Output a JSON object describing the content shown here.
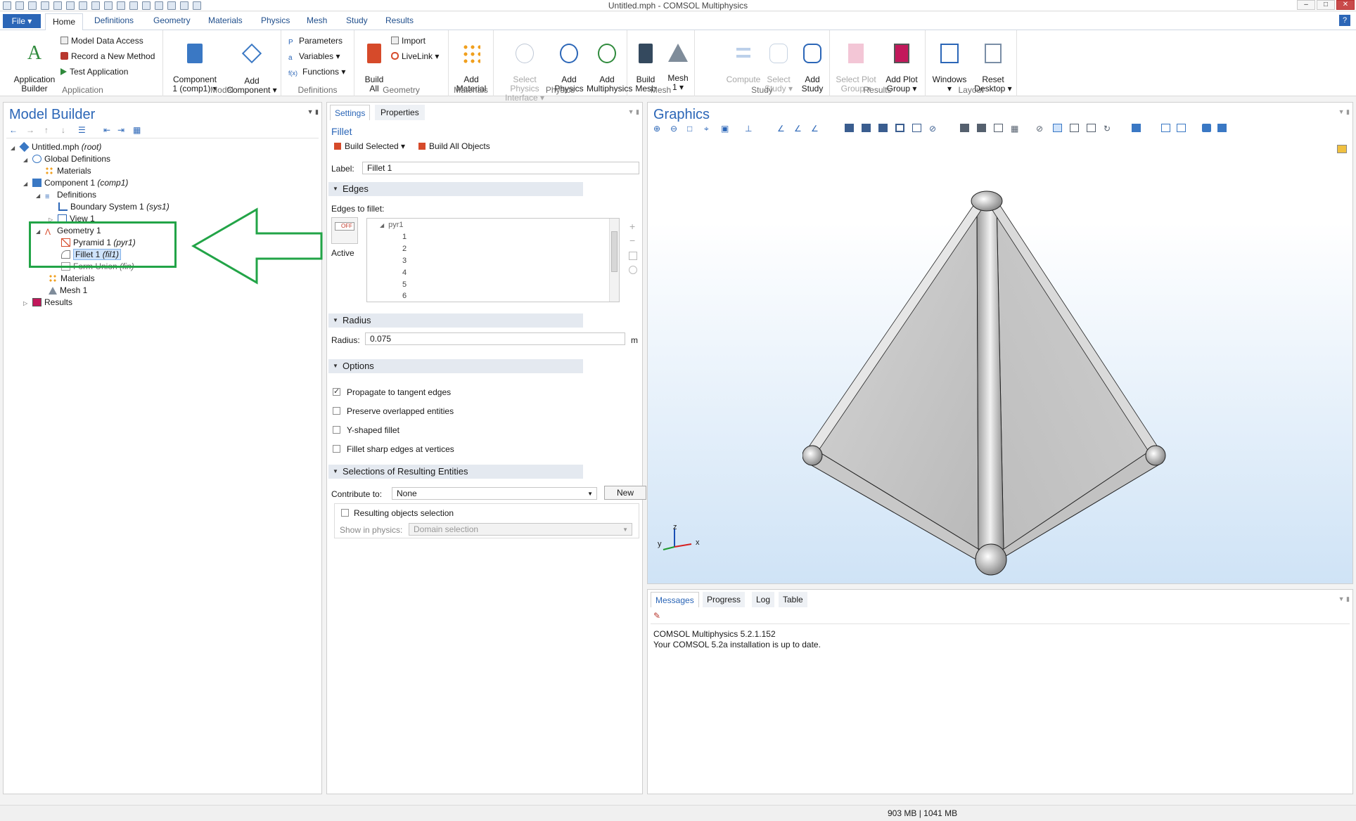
{
  "window": {
    "title": "Untitled.mph - COMSOL Multiphysics",
    "controls": [
      "–",
      "□",
      "✕"
    ]
  },
  "ribbon_tabs": {
    "file": "File ▾",
    "items": [
      "Home",
      "Definitions",
      "Geometry",
      "Materials",
      "Physics",
      "Mesh",
      "Study",
      "Results"
    ],
    "help": "?"
  },
  "ribbon": {
    "application": {
      "group_label": "Application",
      "app_builder": "Application\nBuilder",
      "model_data_access": "Model Data Access",
      "record_method": "Record a New Method",
      "test_application": "Test Application"
    },
    "model": {
      "group_label": "Model",
      "component": "Component\n1 (comp1) ▾",
      "add_component": "Add\nComponent ▾"
    },
    "definitions": {
      "group_label": "Definitions",
      "parameters": "Parameters",
      "variables": "Variables ▾",
      "functions": "Functions ▾"
    },
    "geometry": {
      "group_label": "Geometry",
      "build_all": "Build\nAll",
      "import": "Import",
      "livelink": "LiveLink ▾"
    },
    "materials": {
      "group_label": "Materials",
      "add_material": "Add\nMaterial"
    },
    "physics": {
      "group_label": "Physics",
      "select_physics_interface": "Select Physics\nInterface ▾",
      "add_physics": "Add\nPhysics",
      "add_multiphysics": "Add\nMultiphysics"
    },
    "mesh": {
      "group_label": "Mesh",
      "build_mesh": "Build\nMesh",
      "mesh1": "Mesh\n1 ▾"
    },
    "study": {
      "group_label": "Study",
      "compute": "Compute",
      "select_study": "Select\nStudy ▾",
      "add_study": "Add\nStudy"
    },
    "results": {
      "group_label": "Results",
      "select_plot_group": "Select Plot\nGroup ▾",
      "add_plot_group": "Add Plot\nGroup ▾"
    },
    "layout": {
      "group_label": "Layout",
      "windows": "Windows\n▾",
      "reset_desktop": "Reset\nDesktop ▾"
    }
  },
  "model_builder": {
    "title": "Model Builder",
    "tree": [
      {
        "label": "Untitled.mph",
        "tag": "(root)"
      },
      {
        "label": "Global Definitions",
        "tag": ""
      },
      {
        "label": "Materials",
        "tag": ""
      },
      {
        "label": "Component 1",
        "tag": "(comp1)"
      },
      {
        "label": "Definitions",
        "tag": ""
      },
      {
        "label": "Boundary System 1",
        "tag": "(sys1)"
      },
      {
        "label": "View 1",
        "tag": ""
      },
      {
        "label": "Geometry 1",
        "tag": ""
      },
      {
        "label": "Pyramid 1",
        "tag": "(pyr1)"
      },
      {
        "label": "Fillet 1",
        "tag": "(fil1)"
      },
      {
        "label": "Form Union",
        "tag": "(fin)"
      },
      {
        "label": "Materials",
        "tag": ""
      },
      {
        "label": "Mesh 1",
        "tag": ""
      },
      {
        "label": "Results",
        "tag": ""
      }
    ]
  },
  "settings": {
    "tabs": [
      "Settings",
      "Properties"
    ],
    "node_type": "Fillet",
    "build_selected": "Build Selected ▾",
    "build_all_objects": "Build All Objects",
    "label_caption": "Label:",
    "label_value": "Fillet 1",
    "edges_section": "Edges",
    "edges_to_fillet": "Edges to fillet:",
    "off_toggle": "OFF",
    "active": "Active",
    "edge_list": [
      "pyr1",
      "1",
      "2",
      "3",
      "4",
      "5",
      "6"
    ],
    "radius_section": "Radius",
    "radius_caption": "Radius:",
    "radius_value": "0.075",
    "radius_unit": "m",
    "options_section": "Options",
    "options": [
      {
        "label": "Propagate to tangent edges",
        "checked": true
      },
      {
        "label": "Preserve overlapped entities",
        "checked": false
      },
      {
        "label": "Y-shaped fillet",
        "checked": false
      },
      {
        "label": "Fillet sharp edges at vertices",
        "checked": false
      }
    ],
    "resulting_section": "Selections of Resulting Entities",
    "contribute_caption": "Contribute to:",
    "contribute_value": "None",
    "new_button": "New",
    "resulting_objects": "Resulting objects selection",
    "show_in_physics_caption": "Show in physics:",
    "show_in_physics_value": "Domain selection"
  },
  "graphics": {
    "title": "Graphics",
    "axes": {
      "z": "z",
      "y": "y",
      "x": "x"
    }
  },
  "messages": {
    "tabs": [
      "Messages",
      "Progress",
      "Log",
      "Table"
    ],
    "lines": [
      "COMSOL Multiphysics 5.2.1.152",
      "Your COMSOL 5.2a installation is up to date."
    ]
  },
  "status": {
    "memory": "903 MB | 1041 MB"
  },
  "colors": {
    "accent": "#2b66b7",
    "highlight_box": "#22a447",
    "graphics_bg_top": "#ffffff",
    "graphics_bg_bottom": "#cfe3f6"
  }
}
